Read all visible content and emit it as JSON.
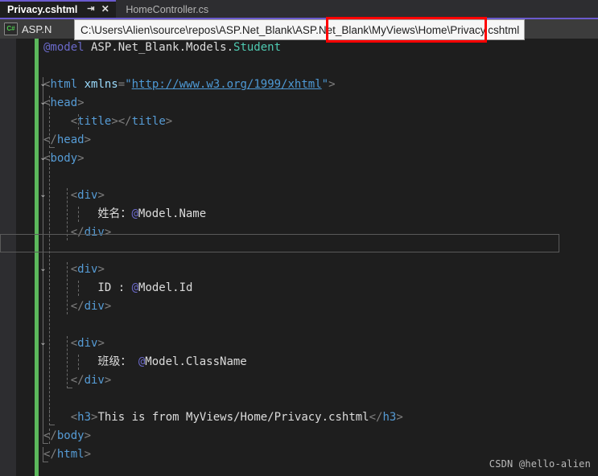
{
  "window": {
    "theme_background": "#1e1e1e",
    "accent_purple": "#6a5acd",
    "change_bar_green": "#5cb85c",
    "annotation_red": "#ff0000"
  },
  "tabs": [
    {
      "label": "Privacy.cshtml",
      "active": true,
      "pin_icon": "pin-icon",
      "close_icon": "close-icon"
    },
    {
      "label": "HomeController.cs",
      "active": false
    }
  ],
  "navbar": {
    "project_icon": "csharp-icon",
    "project_icon_text": "C#",
    "project_label": "ASP.N"
  },
  "tooltip": {
    "path": "C:\\Users\\Alien\\source\\repos\\ASP.Net_Blank\\ASP.Net_Blank\\MyViews\\Home\\Privacy.cshtml"
  },
  "editor": {
    "lines": [
      {
        "n": 1,
        "tokens": [
          {
            "t": "@model",
            "c": "t-kw"
          },
          {
            "t": " ASP.Net_Blank.Models.",
            "c": "t-plain"
          },
          {
            "t": "Student",
            "c": "t-type"
          }
        ]
      },
      {
        "n": 2,
        "tokens": []
      },
      {
        "n": 3,
        "tokens": [
          {
            "t": "<",
            "c": "t-punc"
          },
          {
            "t": "html",
            "c": "t-tag"
          },
          {
            "t": " ",
            "c": "t-plain"
          },
          {
            "t": "xmlns",
            "c": "t-attr"
          },
          {
            "t": "=",
            "c": "t-punc"
          },
          {
            "t": "\"",
            "c": "t-str"
          },
          {
            "t": "http://www.w3.org/1999/xhtml",
            "c": "t-link"
          },
          {
            "t": "\"",
            "c": "t-str"
          },
          {
            "t": ">",
            "c": "t-punc"
          }
        ]
      },
      {
        "n": 4,
        "tokens": [
          {
            "t": "<",
            "c": "t-punc"
          },
          {
            "t": "head",
            "c": "t-tag"
          },
          {
            "t": ">",
            "c": "t-punc"
          }
        ]
      },
      {
        "n": 5,
        "tokens": [
          {
            "t": "    <",
            "c": "t-punc"
          },
          {
            "t": "title",
            "c": "t-tag"
          },
          {
            "t": "></",
            "c": "t-punc"
          },
          {
            "t": "title",
            "c": "t-tag"
          },
          {
            "t": ">",
            "c": "t-punc"
          }
        ]
      },
      {
        "n": 6,
        "tokens": [
          {
            "t": "</",
            "c": "t-punc"
          },
          {
            "t": "head",
            "c": "t-tag"
          },
          {
            "t": ">",
            "c": "t-punc"
          }
        ]
      },
      {
        "n": 7,
        "tokens": [
          {
            "t": "<",
            "c": "t-punc"
          },
          {
            "t": "body",
            "c": "t-tag"
          },
          {
            "t": ">",
            "c": "t-punc"
          }
        ]
      },
      {
        "n": 8,
        "tokens": []
      },
      {
        "n": 9,
        "tokens": [
          {
            "t": "    <",
            "c": "t-punc"
          },
          {
            "t": "div",
            "c": "t-tag"
          },
          {
            "t": ">",
            "c": "t-punc"
          }
        ]
      },
      {
        "n": 10,
        "tokens": [
          {
            "t": "        姓名：",
            "c": "t-text"
          },
          {
            "t": "@",
            "c": "t-at"
          },
          {
            "t": "Model.Name",
            "c": "t-plain"
          }
        ]
      },
      {
        "n": 11,
        "tokens": [
          {
            "t": "    </",
            "c": "t-punc"
          },
          {
            "t": "div",
            "c": "t-tag"
          },
          {
            "t": ">",
            "c": "t-punc"
          }
        ]
      },
      {
        "n": 12,
        "tokens": [],
        "current": true
      },
      {
        "n": 13,
        "tokens": [
          {
            "t": "    <",
            "c": "t-punc"
          },
          {
            "t": "div",
            "c": "t-tag"
          },
          {
            "t": ">",
            "c": "t-punc"
          }
        ]
      },
      {
        "n": 14,
        "tokens": [
          {
            "t": "        ID : ",
            "c": "t-text"
          },
          {
            "t": "@",
            "c": "t-at"
          },
          {
            "t": "Model.Id",
            "c": "t-plain"
          }
        ]
      },
      {
        "n": 15,
        "tokens": [
          {
            "t": "    </",
            "c": "t-punc"
          },
          {
            "t": "div",
            "c": "t-tag"
          },
          {
            "t": ">",
            "c": "t-punc"
          }
        ]
      },
      {
        "n": 16,
        "tokens": []
      },
      {
        "n": 17,
        "tokens": [
          {
            "t": "    <",
            "c": "t-punc"
          },
          {
            "t": "div",
            "c": "t-tag"
          },
          {
            "t": ">",
            "c": "t-punc"
          }
        ]
      },
      {
        "n": 18,
        "tokens": [
          {
            "t": "        班级： ",
            "c": "t-text"
          },
          {
            "t": "@",
            "c": "t-at"
          },
          {
            "t": "Model.ClassName",
            "c": "t-plain"
          }
        ]
      },
      {
        "n": 19,
        "tokens": [
          {
            "t": "    </",
            "c": "t-punc"
          },
          {
            "t": "div",
            "c": "t-tag"
          },
          {
            "t": ">",
            "c": "t-punc"
          }
        ]
      },
      {
        "n": 20,
        "tokens": []
      },
      {
        "n": 21,
        "tokens": [
          {
            "t": "    <",
            "c": "t-punc"
          },
          {
            "t": "h3",
            "c": "t-tag"
          },
          {
            "t": ">",
            "c": "t-punc"
          },
          {
            "t": "This is from MyViews/Home/Privacy.cshtml",
            "c": "t-text"
          },
          {
            "t": "</",
            "c": "t-punc"
          },
          {
            "t": "h3",
            "c": "t-tag"
          },
          {
            "t": ">",
            "c": "t-punc"
          }
        ]
      },
      {
        "n": 22,
        "tokens": [
          {
            "t": "</",
            "c": "t-punc"
          },
          {
            "t": "body",
            "c": "t-tag"
          },
          {
            "t": ">",
            "c": "t-punc"
          }
        ]
      },
      {
        "n": 23,
        "tokens": [
          {
            "t": "</",
            "c": "t-punc"
          },
          {
            "t": "html",
            "c": "t-tag"
          },
          {
            "t": ">",
            "c": "t-punc"
          }
        ]
      }
    ],
    "fold_chevrons": [
      {
        "line": 3
      },
      {
        "line": 4
      },
      {
        "line": 7
      },
      {
        "line": 9
      },
      {
        "line": 13
      },
      {
        "line": 17
      }
    ]
  },
  "watermark": {
    "text": "CSDN @hello-alien"
  }
}
